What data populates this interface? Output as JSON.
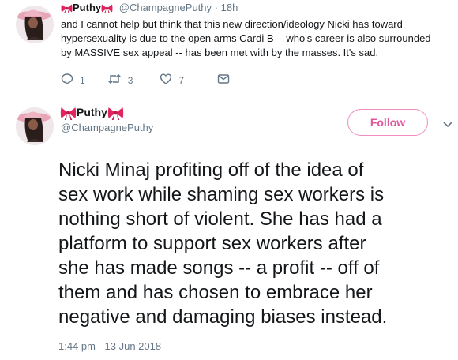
{
  "reply_tweet": {
    "display_name": "Puthy",
    "handle": "@ChampagnePuthy",
    "separator": "·",
    "time": "18h",
    "text": "and I cannot help but think that this new direction/ideology Nicki has toward\nhypersexuality is due to the open arms Cardi B -- who's career is also surrounded\nby MASSIVE sex appeal -- has been met with by the masses. It's sad.",
    "actions": {
      "reply_count": "1",
      "retweet_count": "3",
      "like_count": "7"
    }
  },
  "main_tweet": {
    "display_name": "Puthy",
    "handle": "@ChampagnePuthy",
    "follow_label": "Follow",
    "text": "Nicki Minaj profiting off of the idea of\nsex work while shaming sex workers is\nnothing short of violent. She has had a\nplatform to support sex workers after\nshe has made songs -- a profit -- off of\nthem and has chosen to embrace her\nnegative and damaging biases instead.",
    "timestamp": "1:44 pm - 13 Jun 2018"
  },
  "icons": {
    "bow": "bow-emoji-icon",
    "reply": "reply-icon",
    "retweet": "retweet-icon",
    "like": "heart-icon",
    "dm": "envelope-icon",
    "more": "chevron-down-icon"
  },
  "colors": {
    "accent_pink": "#e0559c",
    "bow_red": "#e0245e",
    "muted": "#657786",
    "text": "#14171a"
  }
}
